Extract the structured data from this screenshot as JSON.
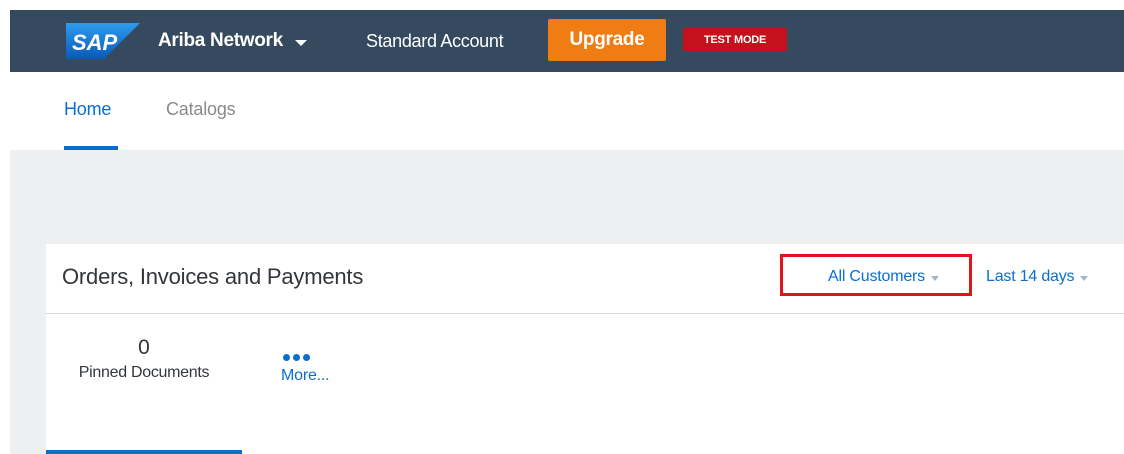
{
  "header": {
    "logo_text": "SAP",
    "brand": "Ariba Network",
    "account_type": "Standard Account",
    "upgrade_label": "Upgrade",
    "mode_badge": "TEST MODE",
    "colors": {
      "bar": "#354a5f",
      "upgrade": "#ef7d14",
      "badge": "#c4111b"
    }
  },
  "tabs": [
    {
      "label": "Home",
      "active": true
    },
    {
      "label": "Catalogs",
      "active": false
    }
  ],
  "panel": {
    "title": "Orders, Invoices and Payments",
    "filters": {
      "customers": "All Customers",
      "period": "Last 14 days"
    },
    "tiles": [
      {
        "count": "0",
        "label": "Pinned Documents",
        "selected": true
      }
    ],
    "more_label": "More..."
  },
  "icons": {
    "brand_caret": "chevron-down-icon",
    "more": "ellipsis-icon",
    "filter_caret": "triangle-down-icon"
  },
  "accent_color": "#0a6ed1",
  "highlight_color": "#e4121b"
}
